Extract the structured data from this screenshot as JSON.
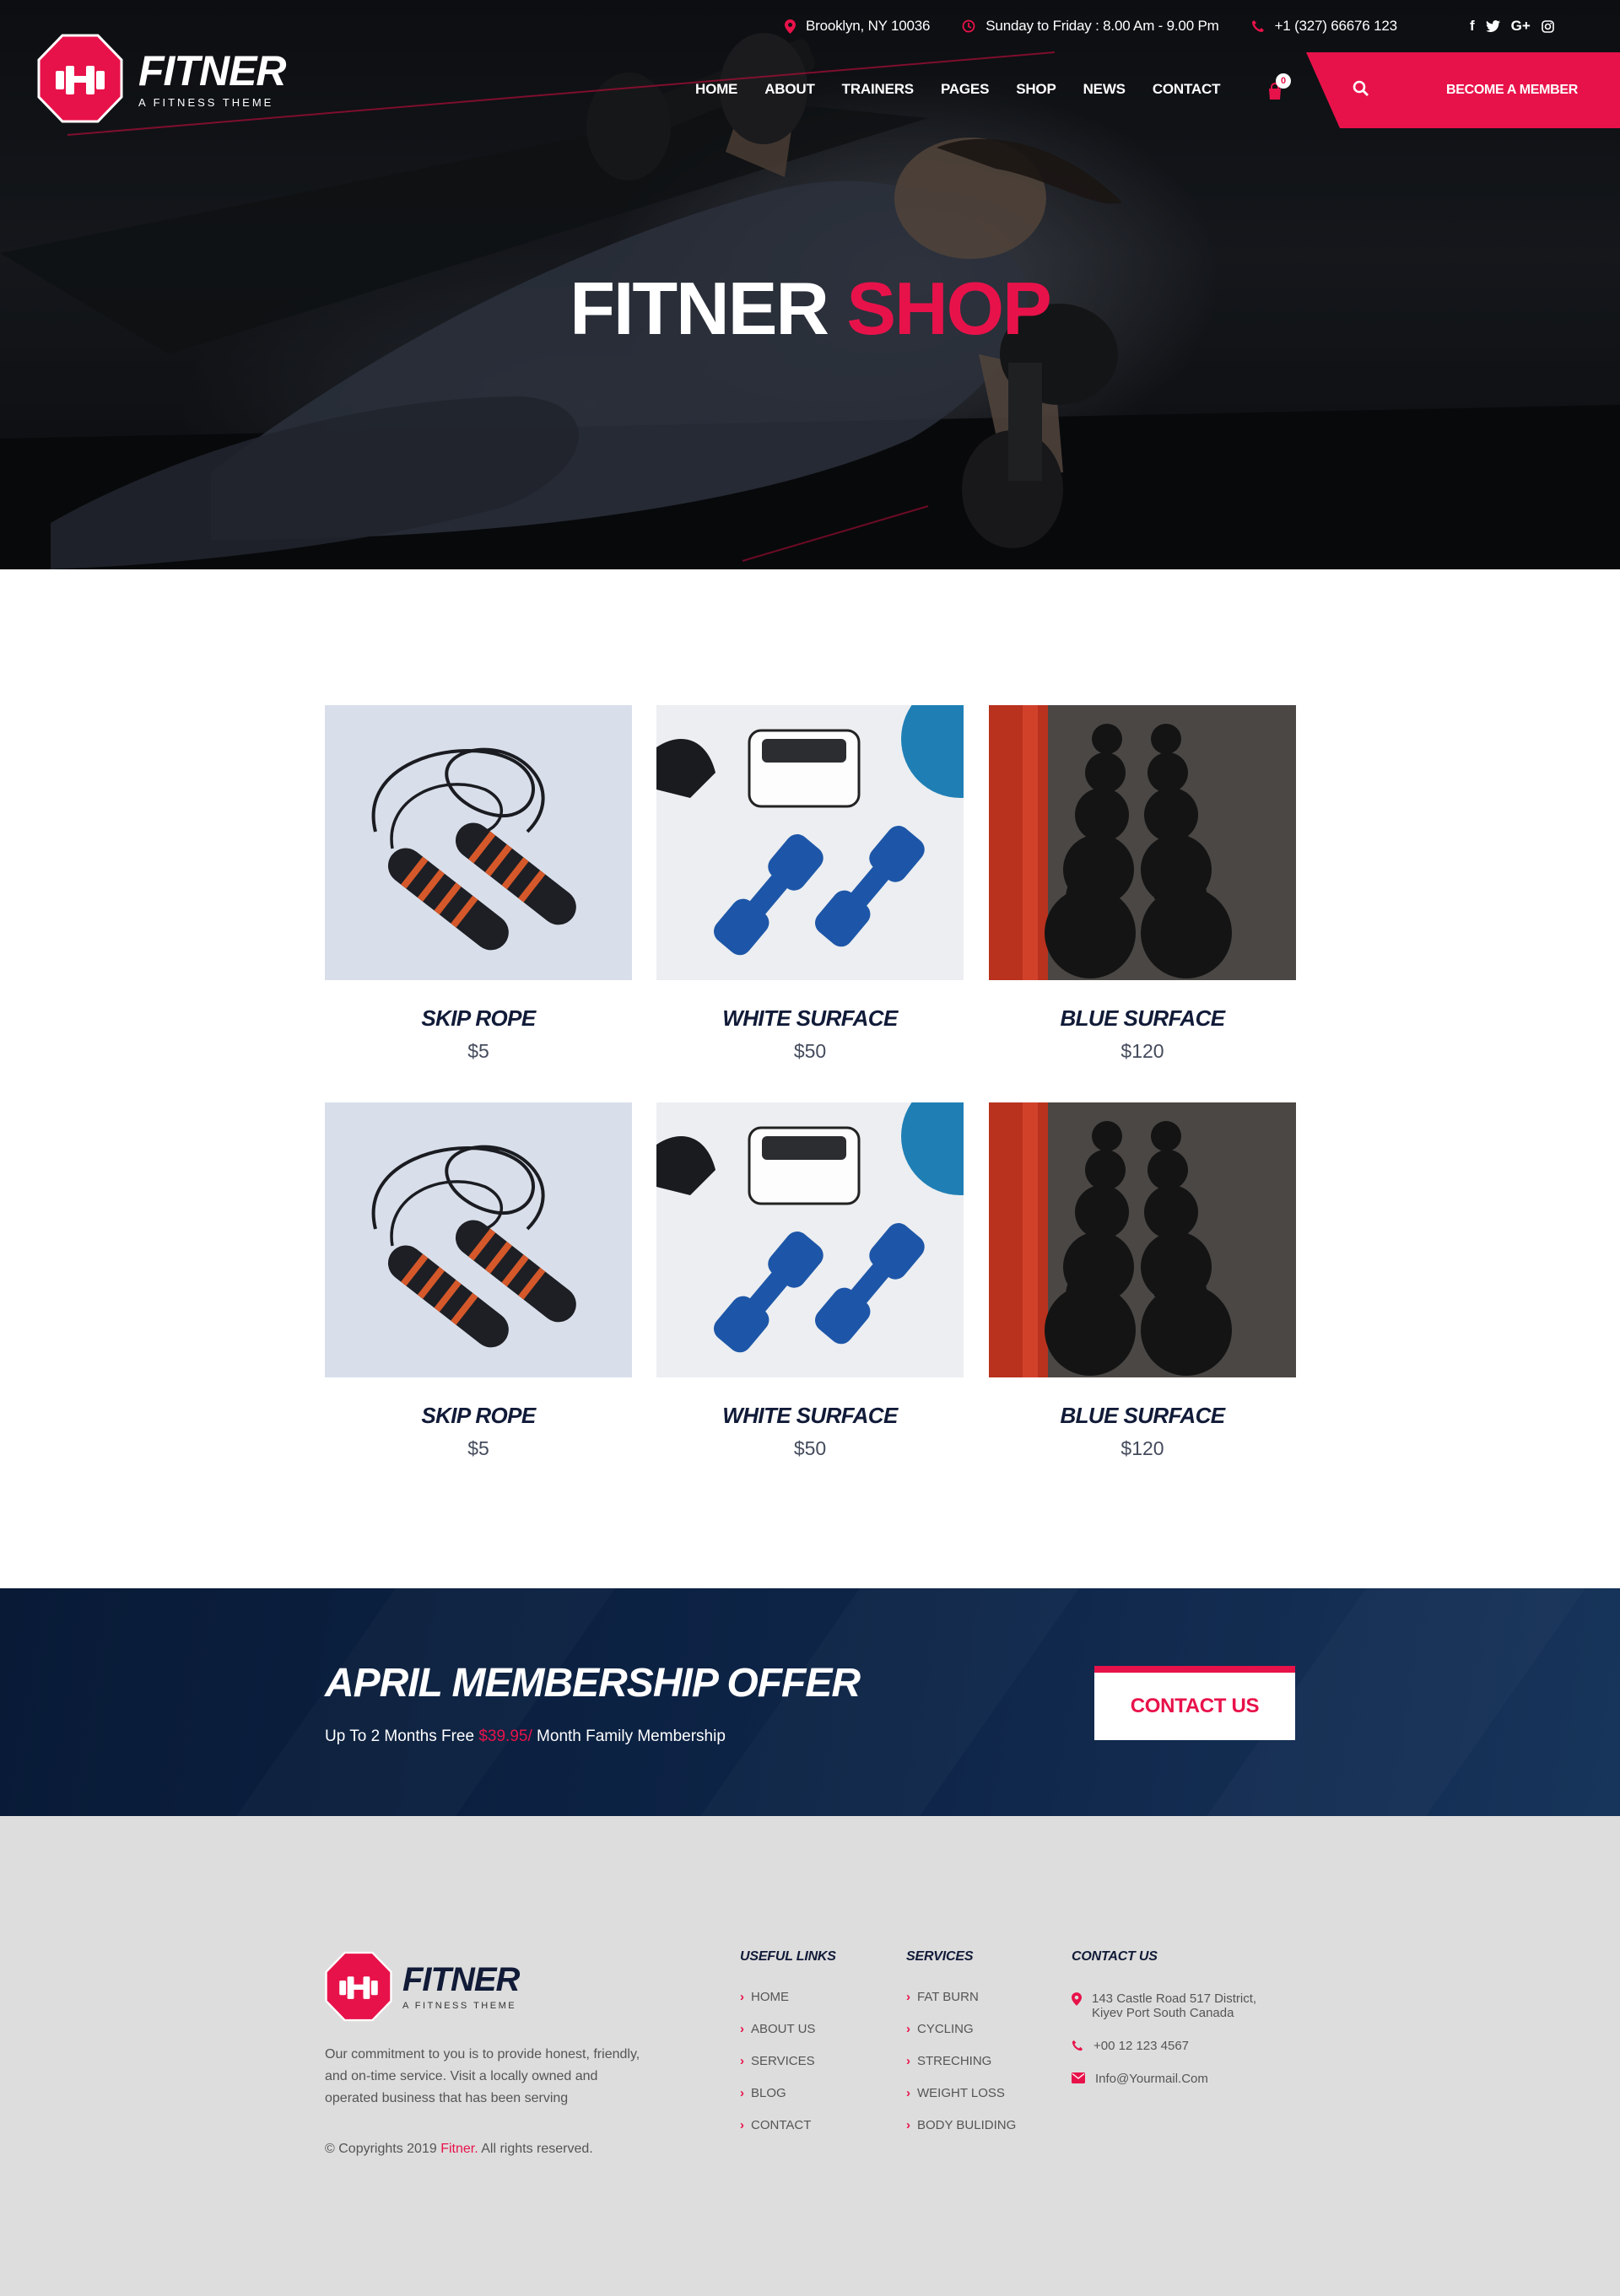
{
  "colors": {
    "accent": "#e8124a",
    "navy": "#0e2548",
    "footer_bg": "#dddddd"
  },
  "topbar": {
    "location": "Brooklyn, NY 10036",
    "hours": "Sunday to Friday : 8.00 Am - 9.00 Pm",
    "phone": "+1 (327) 66676 123",
    "social": [
      "f",
      "twitter",
      "G+",
      "instagram"
    ]
  },
  "brand": {
    "name": "FITNER",
    "tagline": "A FITNESS THEME"
  },
  "nav": {
    "items": [
      "HOME",
      "ABOUT",
      "TRAINERS",
      "PAGES",
      "SHOP",
      "NEWS",
      "CONTACT"
    ],
    "cart_count": "0",
    "member_label": "BECOME A MEMBER"
  },
  "hero": {
    "title_main": "FITNER",
    "title_accent": "SHOP"
  },
  "products": [
    {
      "name": "SKIP ROPE",
      "price": "$5",
      "image": "skip-rope"
    },
    {
      "name": "WHITE SURFACE",
      "price": "$50",
      "image": "blue-dumbbells"
    },
    {
      "name": "BLUE SURFACE",
      "price": "$120",
      "image": "kettlebells"
    },
    {
      "name": "SKIP ROPE",
      "price": "$5",
      "image": "skip-rope"
    },
    {
      "name": "WHITE SURFACE",
      "price": "$50",
      "image": "blue-dumbbells"
    },
    {
      "name": "BLUE SURFACE",
      "price": "$120",
      "image": "kettlebells"
    }
  ],
  "offer": {
    "title": "APRIL MEMBERSHIP OFFER",
    "sub_before": "Up To 2 Months Free",
    "sub_price": "$39.95/",
    "sub_after": "Month Family Membership",
    "button": "CONTACT US"
  },
  "footer": {
    "about": "Our commitment to you is to provide honest, friendly, and on-time service. Visit a locally owned and operated business that has been serving",
    "copy_before": "© Copyrights 2019",
    "copy_brand": "Fitner.",
    "copy_after": "All rights reserved.",
    "useful_links": {
      "title": "USEFUL LINKS",
      "items": [
        "HOME",
        "ABOUT US",
        "SERVICES",
        "BLOG",
        "CONTACT"
      ]
    },
    "services": {
      "title": "SERVICES",
      "items": [
        "FAT BURN",
        "CYCLING",
        "STRECHING",
        "WEIGHT LOSS",
        "BODY BULIDING"
      ]
    },
    "contact": {
      "title": "CONTACT US",
      "address_1": "143 Castle Road 517 District,",
      "address_2": "Kiyev Port South Canada",
      "phone": "+00 12 123 4567",
      "email": "Info@Yourmail.Com"
    }
  }
}
